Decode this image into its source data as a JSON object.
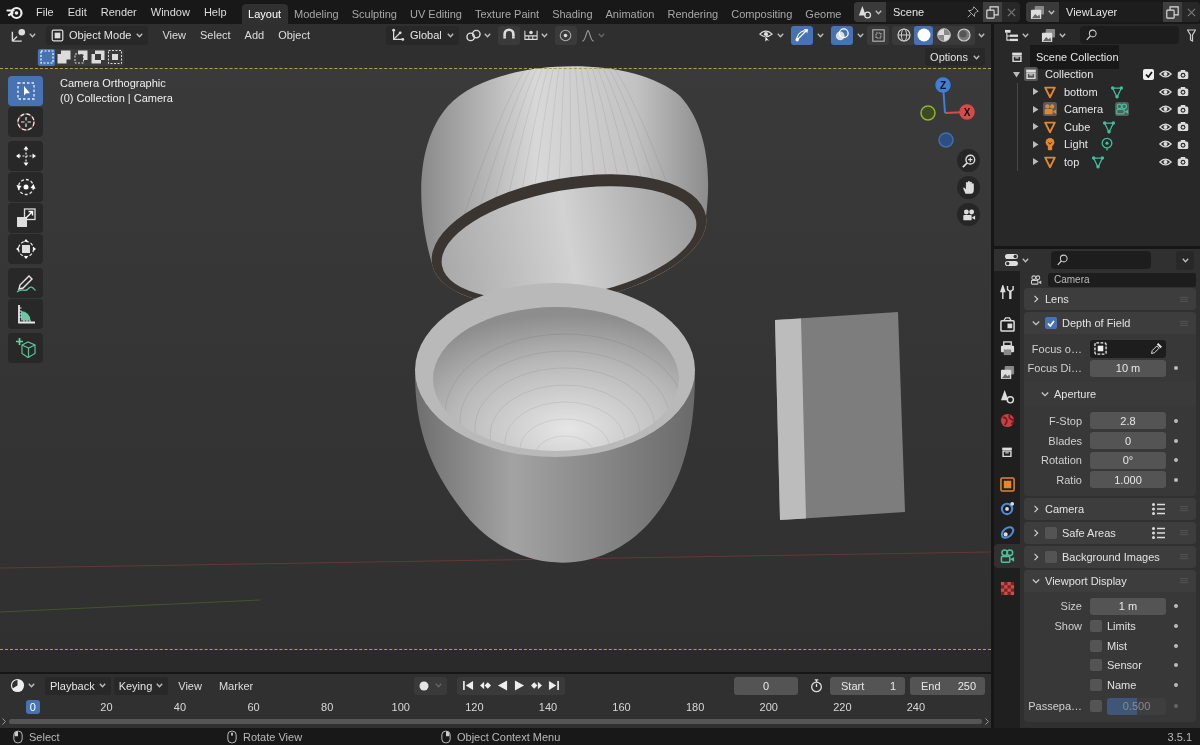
{
  "top_bar": {
    "menus": [
      "File",
      "Edit",
      "Render",
      "Window",
      "Help"
    ],
    "workspace_tabs": [
      {
        "label": "Layout",
        "selected": true
      },
      {
        "label": "Modeling",
        "selected": false
      },
      {
        "label": "Sculpting",
        "selected": false
      },
      {
        "label": "UV Editing",
        "selected": false
      },
      {
        "label": "Texture Paint",
        "selected": false
      },
      {
        "label": "Shading",
        "selected": false
      },
      {
        "label": "Animation",
        "selected": false
      },
      {
        "label": "Rendering",
        "selected": false
      },
      {
        "label": "Compositing",
        "selected": false
      },
      {
        "label": "Geome",
        "selected": false
      }
    ],
    "scene": {
      "name": "Scene"
    },
    "view_layer": {
      "name": "ViewLayer"
    }
  },
  "viewport": {
    "header": {
      "mode": "Object Mode",
      "menus": [
        "View",
        "Select",
        "Add",
        "Object"
      ],
      "orientation": "Global",
      "snapping": {
        "on": false
      },
      "proportional_editing": {
        "on": false
      },
      "gizmos": {
        "on": true
      },
      "overlays": {
        "on": true
      },
      "xray": {
        "on": false
      },
      "shading": [
        {
          "kind": "wireframe",
          "selected": false
        },
        {
          "kind": "solid",
          "selected": true
        },
        {
          "kind": "material",
          "selected": false
        },
        {
          "kind": "rendered",
          "selected": false
        }
      ]
    },
    "selection_modes": [
      {
        "kind": "set",
        "selected": true
      },
      {
        "kind": "extend",
        "selected": false
      },
      {
        "kind": "subtract",
        "selected": false
      },
      {
        "kind": "invert",
        "selected": false
      },
      {
        "kind": "intersect",
        "selected": false
      }
    ],
    "options": "Options",
    "info": [
      "Camera Orthographic",
      "(0) Collection | Camera"
    ],
    "tool_groups": [
      {
        "tools": [
          {
            "kind": "select_box",
            "selected": true
          },
          {
            "kind": "cursor",
            "selected": false
          }
        ]
      },
      {
        "tools": [
          {
            "kind": "move",
            "selected": false
          },
          {
            "kind": "rotate",
            "selected": false
          },
          {
            "kind": "scale",
            "selected": false
          },
          {
            "kind": "transform",
            "selected": false
          }
        ]
      },
      {
        "tools": [
          {
            "kind": "annotate",
            "selected": false
          },
          {
            "kind": "measure",
            "selected": false
          }
        ]
      },
      {
        "tools": [
          {
            "kind": "add_cube",
            "selected": false
          }
        ]
      }
    ],
    "navigation": {
      "axes": [
        {
          "kind": "z",
          "label": "Z"
        },
        {
          "kind": "x",
          "label": "X"
        },
        {
          "kind": "y"
        },
        {
          "kind": "neg_z"
        }
      ]
    }
  },
  "outliner": {
    "tree": [
      {
        "label": "Scene Collection",
        "kind": "scene_collection",
        "children": [
          {
            "label": "Collection",
            "kind": "collection",
            "expanded": true,
            "checked": true,
            "children": [
              {
                "label": "bottom",
                "kind": "mesh",
                "expanded": false,
                "active": false
              },
              {
                "label": "Camera",
                "kind": "camera",
                "expanded": false,
                "active": true
              },
              {
                "label": "Cube",
                "kind": "mesh",
                "expanded": false,
                "active": false
              },
              {
                "label": "Light",
                "kind": "light",
                "expanded": false,
                "active": false
              },
              {
                "label": "top",
                "kind": "mesh",
                "expanded": false,
                "active": false
              }
            ]
          }
        ]
      }
    ]
  },
  "properties": {
    "tab_groups": [
      {
        "tabs": [
          {
            "kind": "tool",
            "selected": false
          }
        ]
      },
      {
        "tabs": [
          {
            "kind": "render",
            "selected": false
          },
          {
            "kind": "output",
            "selected": false
          },
          {
            "kind": "view_layer",
            "selected": false
          },
          {
            "kind": "scene",
            "selected": false
          },
          {
            "kind": "world",
            "selected": false
          }
        ]
      },
      {
        "tabs": [
          {
            "kind": "collection",
            "selected": false
          }
        ]
      },
      {
        "tabs": [
          {
            "kind": "object",
            "selected": false
          },
          {
            "kind": "physics",
            "selected": false
          },
          {
            "kind": "constraints",
            "selected": false
          },
          {
            "kind": "camera_data",
            "selected": true
          }
        ]
      },
      {
        "tabs": [
          {
            "kind": "texture",
            "selected": false
          }
        ]
      }
    ],
    "data_name": "Camera",
    "panels": [
      {
        "title": "Lens",
        "expanded": false
      },
      {
        "title": "Depth of Field",
        "expanded": true,
        "checked": true,
        "rows": [
          {
            "kind": "object_field",
            "label": "Focus o…"
          },
          {
            "kind": "number",
            "label": "Focus Di…",
            "value": "10 m"
          }
        ],
        "subpanels": [
          {
            "title": "Aperture",
            "expanded": true,
            "rows": [
              {
                "kind": "number",
                "label": "F-Stop",
                "value": "2.8"
              },
              {
                "kind": "number",
                "label": "Blades",
                "value": "0"
              },
              {
                "kind": "number",
                "label": "Rotation",
                "value": "0°"
              },
              {
                "kind": "number",
                "label": "Ratio",
                "value": "1.000"
              }
            ]
          }
        ]
      },
      {
        "title": "Camera",
        "expanded": false,
        "presets": true
      },
      {
        "title": "Safe Areas",
        "expanded": false,
        "checked": false,
        "presets": true
      },
      {
        "title": "Background Images",
        "expanded": false,
        "checked": false
      },
      {
        "title": "Viewport Display",
        "expanded": true,
        "rows": [
          {
            "kind": "number",
            "label": "Size",
            "value": "1 m"
          },
          {
            "kind": "checkbox",
            "label": "Show",
            "text": "Limits",
            "checked": false
          },
          {
            "kind": "checkbox",
            "text": "Mist",
            "checked": false
          },
          {
            "kind": "checkbox",
            "text": "Sensor",
            "checked": false
          },
          {
            "kind": "checkbox",
            "text": "Name",
            "checked": false
          },
          {
            "kind": "slider",
            "label": "Passepa…",
            "checked": false,
            "value": "0.500",
            "level": 0.5,
            "disabled": true
          }
        ]
      }
    ]
  },
  "timeline": {
    "menus": [
      {
        "label": "Playback",
        "kind": "dropdown"
      },
      {
        "label": "Keying",
        "kind": "dropdown"
      },
      {
        "label": "View",
        "kind": "menu"
      },
      {
        "label": "Marker",
        "kind": "menu"
      }
    ],
    "auto_keying": {
      "on": false
    },
    "current_frame": "0",
    "start": {
      "label": "Start",
      "value": "1"
    },
    "end": {
      "label": "End",
      "value": "250"
    },
    "ruler": [
      {
        "label": "0",
        "selected": true
      },
      {
        "label": "20",
        "selected": false
      },
      {
        "label": "40",
        "selected": false
      },
      {
        "label": "60",
        "selected": false
      },
      {
        "label": "80",
        "selected": false
      },
      {
        "label": "100",
        "selected": false
      },
      {
        "label": "120",
        "selected": false
      },
      {
        "label": "140",
        "selected": false
      },
      {
        "label": "160",
        "selected": false
      },
      {
        "label": "180",
        "selected": false
      },
      {
        "label": "200",
        "selected": false
      },
      {
        "label": "220",
        "selected": false
      },
      {
        "label": "240",
        "selected": false
      }
    ]
  },
  "status_bar": {
    "hints": [
      {
        "kind": "left_click",
        "label": "Select"
      },
      {
        "kind": "middle_click",
        "label": "Rotate View"
      },
      {
        "kind": "right_click",
        "label": "Object Context Menu"
      }
    ],
    "version": "3.5.1"
  }
}
